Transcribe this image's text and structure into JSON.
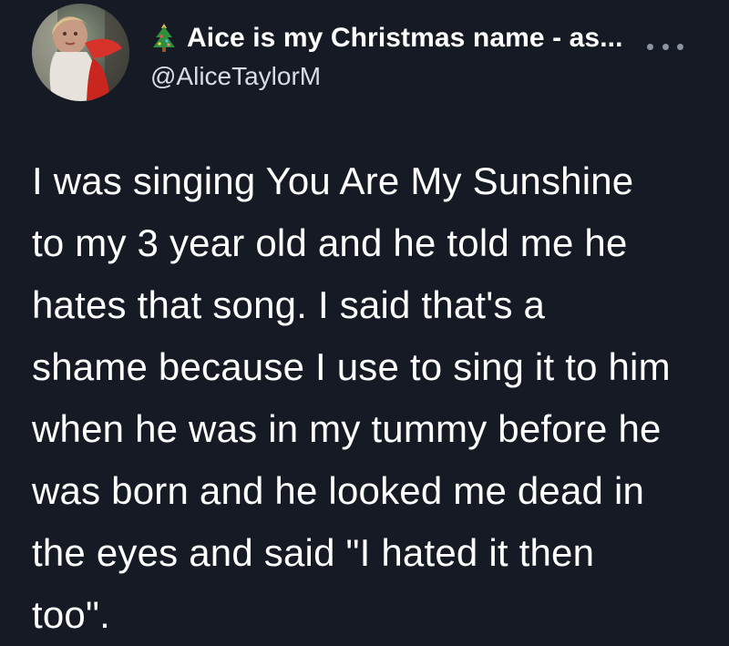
{
  "header": {
    "display_name": "Aice is my Christmas name - as...",
    "handle": "@AliceTaylorM",
    "name_emoji_icon": "christmas-tree-icon",
    "more_icon": "ellipsis-icon"
  },
  "tweet": {
    "text": "I was singing You Are My Sunshine\nto my 3 year old and he told me he\nhates that song. I said that's a\nshame because I use to sing it to him\nwhen he was in my tummy before he\nwas born and he looked me dead in\nthe eyes and said \"I hated it then\ntoo\"."
  },
  "colors": {
    "background": "#151a24",
    "text": "#ffffff",
    "handle": "#d9dce2",
    "muted": "#8d95a3"
  }
}
